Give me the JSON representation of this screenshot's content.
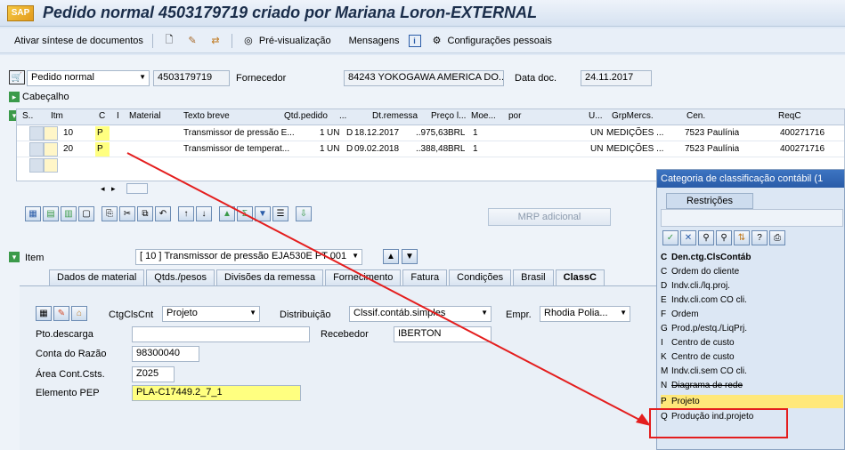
{
  "window": {
    "title": "Pedido normal 4503179719 criado por Mariana Loron-EXTERNAL",
    "logo": "SAP"
  },
  "toolbar": {
    "doc_summary": "Ativar síntese de documentos",
    "preview": "Pré-visualização",
    "messages": "Mensagens",
    "personal_settings": "Configurações pessoais"
  },
  "header": {
    "doc_type": "Pedido normal",
    "doc_number": "4503179719",
    "vendor_label": "Fornecedor",
    "vendor_value": "84243 YOKOGAWA AMERICA DO...",
    "doc_date_label": "Data doc.",
    "doc_date_value": "24.11.2017",
    "section_label": "Cabeçalho"
  },
  "grid": {
    "columns": [
      "S..",
      "Itm",
      "C",
      "I",
      "Material",
      "Texto breve",
      "Qtd.pedido",
      "...",
      "Dt.remessa",
      "Preço l...",
      "Moe...",
      "por",
      "U...",
      "GrpMercs.",
      "Cen.",
      "ReqC"
    ],
    "rows": [
      {
        "itm": "10",
        "c": "P",
        "text": "Transmissor de pressão E...",
        "qty": "1",
        "unit": "UN",
        "d": "D",
        "date": "18.12.2017",
        "price": "..975,63",
        "cur": "BRL",
        "per": "1",
        "u": "UN",
        "grp": "MEDIÇÕES ...",
        "plant": "7523 Paulínia",
        "req": "400271716"
      },
      {
        "itm": "20",
        "c": "P",
        "text": "Transmissor de temperat...",
        "qty": "1",
        "unit": "UN",
        "d": "D",
        "date": "09.02.2018",
        "price": "..388,48",
        "cur": "BRL",
        "per": "1",
        "u": "UN",
        "grp": "MEDIÇÕES ...",
        "plant": "7523 Paulínia",
        "req": "400271716"
      }
    ]
  },
  "mrp_button": "MRP adicional",
  "item": {
    "label": "Item",
    "selected": "[ 10 ] Transmissor de pressão EJA530E PT 001"
  },
  "tabs": [
    "Dados de material",
    "Qtds./pesos",
    "Divisões da remessa",
    "Fornecimento",
    "Fatura",
    "Condições",
    "Brasil",
    "ClassC"
  ],
  "acct": {
    "ctg_label": "CtgClsCnt",
    "ctg_value": "Projeto",
    "dist_label": "Distribuição",
    "dist_value": "Clssif.contáb.simples",
    "empr_label": "Empr.",
    "empr_value": "Rhodia Polia...",
    "unload_label": "Pto.descarga",
    "unload_value": "",
    "recipient_label": "Recebedor",
    "recipient_value": "IBERTON",
    "gl_label": "Conta do Razão",
    "gl_value": "98300040",
    "area_label": "Área Cont.Csts.",
    "area_value": "Z025",
    "wbs_label": "Elemento PEP",
    "wbs_value": "PLA-C17449.2_7_1"
  },
  "popup": {
    "title": "Categoria de classificação contábil (1",
    "tab": "Restrições",
    "header_key": "C",
    "header_label": "Den.ctg.ClsContáb",
    "items": [
      {
        "k": "C",
        "label": "Ordem do cliente"
      },
      {
        "k": "D",
        "label": "Indv.cli./lq.proj."
      },
      {
        "k": "E",
        "label": "Indv.cli.com CO cli."
      },
      {
        "k": "F",
        "label": "Ordem"
      },
      {
        "k": "G",
        "label": "Prod.p/estq./LiqPrj."
      },
      {
        "k": "I",
        "label": "Centro de custo"
      },
      {
        "k": "K",
        "label": "Centro de custo"
      },
      {
        "k": "M",
        "label": "Indv.cli.sem CO cli."
      },
      {
        "k": "N",
        "label": "Diagrama de rede"
      },
      {
        "k": "P",
        "label": "Projeto"
      },
      {
        "k": "Q",
        "label": "Produção ind.projeto"
      }
    ]
  },
  "colors": {
    "highlight": "#ffff80",
    "annotation": "#e41e1e",
    "title_blue": "#2a5ca8"
  }
}
